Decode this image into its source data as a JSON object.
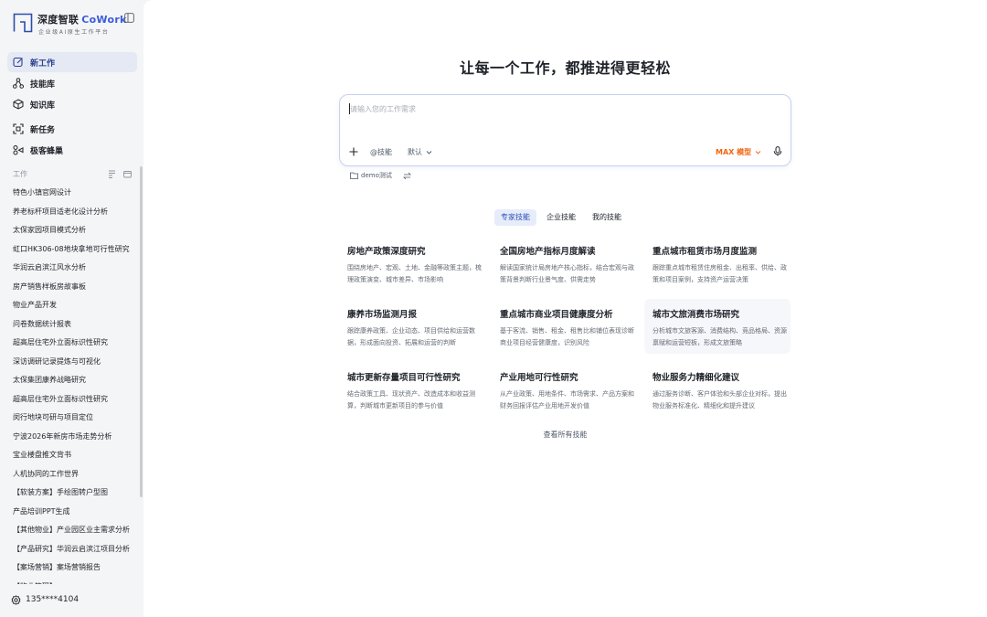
{
  "brand": {
    "name": "深度智联",
    "product": "CoWork",
    "tagline": "企业级AI原生工作平台"
  },
  "nav": {
    "items": [
      {
        "label": "新工作",
        "icon": "edit-icon",
        "active": true
      },
      {
        "label": "技能库",
        "icon": "nodes-icon"
      },
      {
        "label": "知识库",
        "icon": "cube-icon"
      },
      {
        "label": "新任务",
        "icon": "frame-icon"
      },
      {
        "label": "极客蜂巢",
        "icon": "hive-icon"
      }
    ]
  },
  "work_section": {
    "title": "工作",
    "items": [
      "特色小镇官网设计",
      "养老标杆项目适老化设计分析",
      "太保家园项目模式分析",
      "虹口HK306-08地块拿地可行性研究",
      "华润云启滨江风水分析",
      "房产销售样板房故事板",
      "物业产品开发",
      "问卷数据统计报表",
      "超高层住宅外立面标识性研究",
      "深访调研记录提炼与可视化",
      "太保集团康养战略研究",
      "超高层住宅外立面标识性研究",
      "闵行地块可研与项目定位",
      "宁波2026年新房市场走势分析",
      "宝业楼盘推文背书",
      "人机协同的工作世界",
      "【软装方案】手绘图转户型图",
      "产品培训PPT生成",
      "【其他物业】产业园区业主需求分析",
      "【产品研究】华润云启滨江项目分析",
      "【案场营销】案场营销报告",
      "【物业管理】"
    ]
  },
  "user": {
    "label": "135****4104"
  },
  "main": {
    "headline": "让每一个工作，都推进得更轻松",
    "composer": {
      "placeholder": "请输入您的工作需求",
      "skill_label": "@技能",
      "default_label": "默认",
      "model_label": "MAX 模型"
    },
    "folder_label": "demo测试",
    "tabs": [
      {
        "label": "专家技能",
        "active": true
      },
      {
        "label": "企业技能"
      },
      {
        "label": "我的技能"
      }
    ],
    "cards": [
      {
        "title": "房地产政策深度研究",
        "desc": "围绕房地产、宏观、土地、金融等政策主题，梳理政策演变、城市差异、市场影响"
      },
      {
        "title": "全国房地产指标月度解读",
        "desc": "解读国家统计局房地产核心指标，结合宏观与政策背景判断行业景气度、供需走势"
      },
      {
        "title": "重点城市租赁市场月度监测",
        "desc": "跟踪重点城市租赁住房租金、出租率、供给、政策和项目案例，支持资产运营决策"
      },
      {
        "title": "康养市场监测月报",
        "desc": "跟踪康养政策、企业动态、项目供给和运营数据，形成面向投资、拓展和运营的判断"
      },
      {
        "title": "重点城市商业项目健康度分析",
        "desc": "基于客流、销售、租金、租售比和铺位表现诊断商业项目经营健康度，识别风险"
      },
      {
        "title": "城市文旅消费市场研究",
        "desc": "分析城市文旅客源、消费结构、竞品格局、资源禀赋和运营短板，形成文旅策略"
      },
      {
        "title": "城市更新存量项目可行性研究",
        "desc": "结合政策工具、现状资产、改造成本和收益测算，判断城市更新项目的参与价值"
      },
      {
        "title": "产业用地可行性研究",
        "desc": "从产业政策、用地条件、市场需求、产品方案和财务回报评估产业用地开发价值"
      },
      {
        "title": "物业服务力精细化建议",
        "desc": "通过服务诊断、客户体验和头部企业对标，提出物业服务标准化、精细化和提升建议"
      }
    ],
    "view_all": "查看所有技能"
  },
  "colors": {
    "accent": "#3b5bdb",
    "model_orange": "#f2650f",
    "active_nav_bg": "#e5e9f3"
  }
}
